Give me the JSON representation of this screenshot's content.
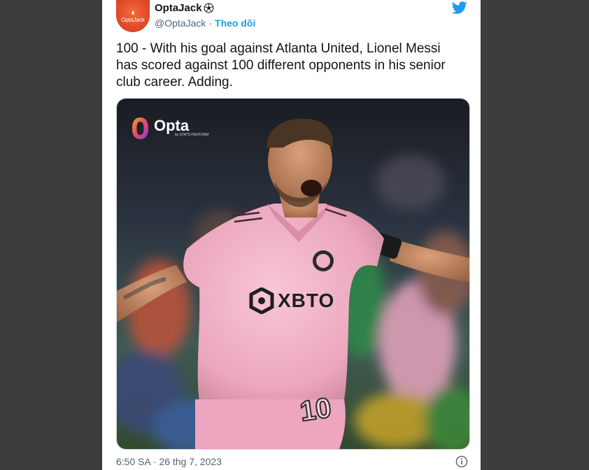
{
  "tweet": {
    "avatar_label": "OptaJack",
    "display_name": "OptaJack",
    "handle": "@OptaJack",
    "separator": "·",
    "follow_label": "Theo dõi",
    "text": "100 - With his goal against Atlanta United, Lionel Messi has scored against 100 different opponents in his senior club career. Adding.",
    "timestamp": "6:50 SA · 26 thg 7, 2023"
  },
  "media": {
    "logo_text": "Opta",
    "logo_sub": "by STATS PERFORM",
    "sponsor_text": "XBTO",
    "shirt_number": "10"
  },
  "icons": {
    "brand": "twitter-bird-icon",
    "verified_emoji": "soccer-ball-icon",
    "info": "info-icon"
  },
  "colors": {
    "accent": "#1d9bf0",
    "avatar": "#e8502b",
    "jersey": "#f4b6c8",
    "background": "#3d3d3d"
  }
}
